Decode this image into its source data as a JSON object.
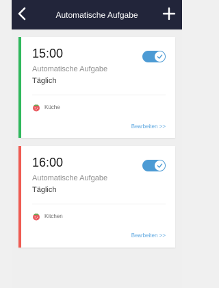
{
  "header": {
    "title": "Automatische Aufgabe",
    "background": "#22253a"
  },
  "tasks": [
    {
      "time": "15:00",
      "name": "Automatische Aufgabe",
      "frequency": "Täglich",
      "room": "Küche",
      "edit_label": "Bearbeiten >>",
      "enabled": true,
      "stripe_color": "#2fb85c"
    },
    {
      "time": "16:00",
      "name": "Automatische Aufgabe",
      "frequency": "Täglich",
      "room": "Kitchen",
      "edit_label": "Bearbeiten >>",
      "enabled": true,
      "stripe_color": "#ef5b52"
    }
  ],
  "colors": {
    "toggle_on": "#4d9bd4",
    "link": "#5fa8e0",
    "background": "#efefef"
  }
}
